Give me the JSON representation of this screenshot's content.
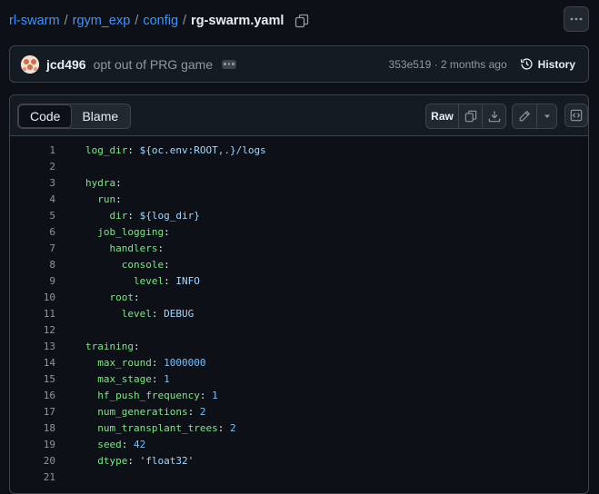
{
  "breadcrumb": {
    "segments": [
      "rl-swarm",
      "rgym_exp",
      "config"
    ],
    "separator": "/",
    "file": "rg-swarm.yaml"
  },
  "icons": {
    "copy_path": "copy-icon",
    "more": "kebab-horizontal-icon",
    "history": "history-icon",
    "copy": "copy-icon",
    "download": "download-icon",
    "edit": "pencil-icon",
    "dropdown": "triangle-down-icon",
    "symbols": "code-square-icon"
  },
  "commit": {
    "author": "jcd496",
    "message": "opt out of PRG game",
    "hash_time": "353e519 · 2 months ago",
    "history_label": "History"
  },
  "file_header": {
    "tabs": [
      "Code",
      "Blame"
    ],
    "active_tab": "Code",
    "raw_label": "Raw"
  },
  "colors": {
    "background": "#0d1117",
    "link": "#4493f8",
    "yaml_key": "#7ee787",
    "yaml_value": "#a5d6ff",
    "yaml_number": "#79c0ff"
  },
  "code": {
    "lines": [
      {
        "n": "1",
        "indent": "",
        "key": "log_dir",
        "sep": ": ",
        "value": "${oc.env:ROOT,.}/logs",
        "vtype": "v"
      },
      {
        "n": "2",
        "indent": "",
        "key": "",
        "sep": "",
        "value": "",
        "vtype": "v"
      },
      {
        "n": "3",
        "indent": "",
        "key": "hydra",
        "sep": ":",
        "value": "",
        "vtype": "v"
      },
      {
        "n": "4",
        "indent": "  ",
        "key": "run",
        "sep": ":",
        "value": "",
        "vtype": "v"
      },
      {
        "n": "5",
        "indent": "    ",
        "key": "dir",
        "sep": ": ",
        "value": "${log_dir}",
        "vtype": "v"
      },
      {
        "n": "6",
        "indent": "  ",
        "key": "job_logging",
        "sep": ":",
        "value": "",
        "vtype": "v"
      },
      {
        "n": "7",
        "indent": "    ",
        "key": "handlers",
        "sep": ":",
        "value": "",
        "vtype": "v"
      },
      {
        "n": "8",
        "indent": "      ",
        "key": "console",
        "sep": ":",
        "value": "",
        "vtype": "v"
      },
      {
        "n": "9",
        "indent": "        ",
        "key": "level",
        "sep": ": ",
        "value": "INFO",
        "vtype": "v"
      },
      {
        "n": "10",
        "indent": "    ",
        "key": "root",
        "sep": ":",
        "value": "",
        "vtype": "v"
      },
      {
        "n": "11",
        "indent": "      ",
        "key": "level",
        "sep": ": ",
        "value": "DEBUG",
        "vtype": "v"
      },
      {
        "n": "12",
        "indent": "",
        "key": "",
        "sep": "",
        "value": "",
        "vtype": "v"
      },
      {
        "n": "13",
        "indent": "",
        "key": "training",
        "sep": ":",
        "value": "",
        "vtype": "v"
      },
      {
        "n": "14",
        "indent": "  ",
        "key": "max_round",
        "sep": ": ",
        "value": "1000000",
        "vtype": "n"
      },
      {
        "n": "15",
        "indent": "  ",
        "key": "max_stage",
        "sep": ": ",
        "value": "1",
        "vtype": "n"
      },
      {
        "n": "16",
        "indent": "  ",
        "key": "hf_push_frequency",
        "sep": ": ",
        "value": "1",
        "vtype": "n"
      },
      {
        "n": "17",
        "indent": "  ",
        "key": "num_generations",
        "sep": ": ",
        "value": "2",
        "vtype": "n"
      },
      {
        "n": "18",
        "indent": "  ",
        "key": "num_transplant_trees",
        "sep": ": ",
        "value": "2",
        "vtype": "n"
      },
      {
        "n": "19",
        "indent": "  ",
        "key": "seed",
        "sep": ": ",
        "value": "42",
        "vtype": "n"
      },
      {
        "n": "20",
        "indent": "  ",
        "key": "dtype",
        "sep": ": ",
        "value": "'float32'",
        "vtype": "v"
      },
      {
        "n": "21",
        "indent": "",
        "key": "",
        "sep": "",
        "value": "",
        "vtype": "v"
      }
    ]
  }
}
